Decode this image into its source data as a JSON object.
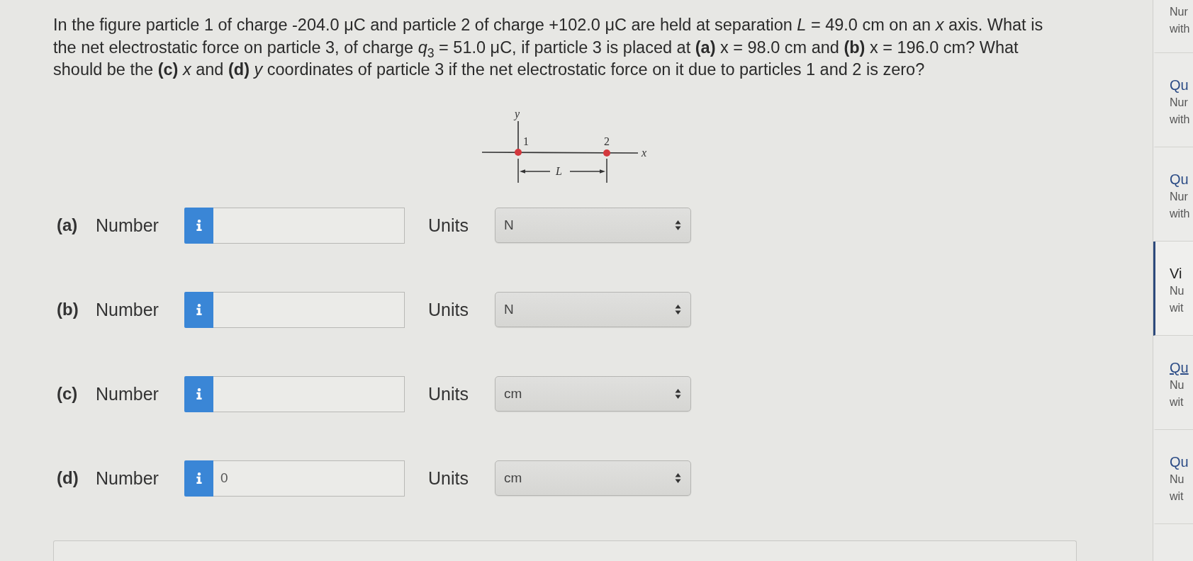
{
  "question": {
    "text": "In the figure particle 1 of charge -204.0 μC and particle 2 of charge +102.0 μC are held at separation *L* = 49.0 cm on an *x* axis. What is the net electrostatic force on particle 3, of charge *q*$_{3}$ = 51.0 μC, if particle 3 is placed at **(a)** x = 98.0 cm and **(b)** x = 196.0 cm? What should be the **(c)** *x* and **(d)** *y* coordinates of particle 3 if the net electrostatic force on it due to particles 1 and 2 is zero?"
  },
  "figure": {
    "y_axis_label": "y",
    "x_axis_label": "x",
    "particles": [
      {
        "label": "1"
      },
      {
        "label": "2"
      }
    ],
    "distance_label": "L"
  },
  "parts": [
    {
      "label": "(a)",
      "field_label": "Number",
      "units_label": "Units",
      "unit": "N"
    },
    {
      "label": "(b)",
      "field_label": "Number",
      "units_label": "Units",
      "unit": "N"
    },
    {
      "label": "(c)",
      "field_label": "Number",
      "units_label": "Units",
      "unit": "cm"
    },
    {
      "label": "(d)",
      "field_label": "Number",
      "value": "0",
      "units_label": "Units",
      "unit": "cm"
    }
  ],
  "sidebar": {
    "items": [
      {
        "lines": [
          "Nur",
          "with"
        ],
        "selected": false,
        "focused": false
      },
      {
        "title": "Qu",
        "lines": [
          "Nur",
          "with"
        ],
        "selected": false,
        "focused": false
      },
      {
        "title": "Qu",
        "lines": [
          "Nur",
          "with"
        ],
        "selected": false,
        "focused": false
      },
      {
        "title": "Vi",
        "lines": [
          "Nu",
          "wit"
        ],
        "selected": true,
        "focused": false
      },
      {
        "title": "Qu",
        "lines": [
          "Nu",
          "wit"
        ],
        "selected": false,
        "focused": true
      },
      {
        "title": "Qu",
        "lines": [
          "Nu",
          "wit"
        ],
        "selected": false,
        "focused": false
      }
    ]
  }
}
